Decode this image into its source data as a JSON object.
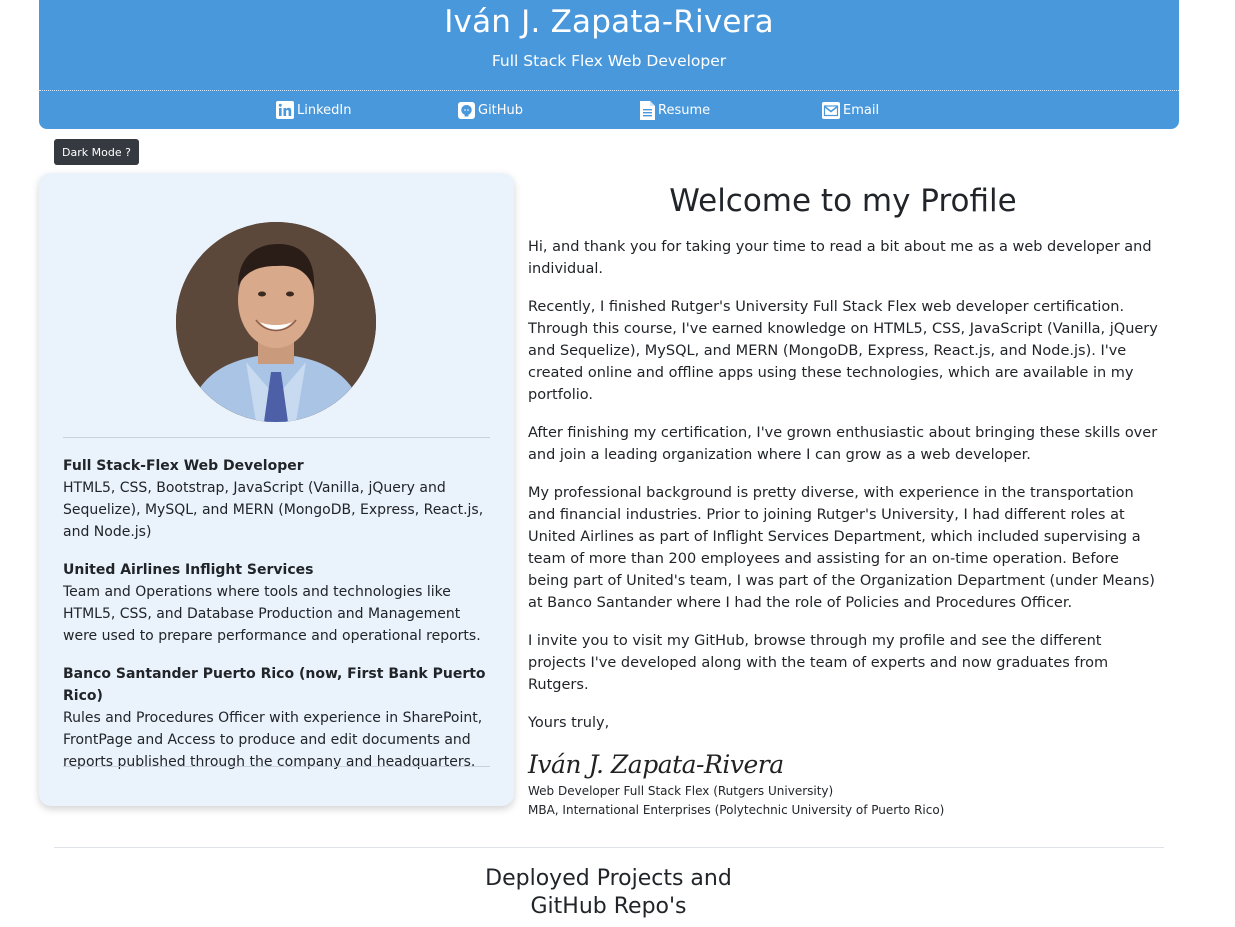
{
  "header": {
    "name": "Iván J. Zapata-Rivera",
    "subtitle": "Full Stack Flex Web Developer",
    "nav": [
      {
        "label": "LinkedIn",
        "icon": "linkedin-icon"
      },
      {
        "label": "GitHub",
        "icon": "github-icon"
      },
      {
        "label": "Resume",
        "icon": "document-icon"
      },
      {
        "label": "Email",
        "icon": "envelope-icon"
      }
    ]
  },
  "dark_mode_button": "Dark Mode ?",
  "sidebar": {
    "experience": [
      {
        "title": "Full Stack-Flex Web Developer",
        "text": "HTML5, CSS, Bootstrap, JavaScript (Vanilla, jQuery and Sequelize), MySQL, and MERN (MongoDB, Express, React.js, and Node.js)"
      },
      {
        "title": "United Airlines Inflight Services",
        "text": "Team and Operations where tools and technologies like HTML5, CSS, and Database Production and Management were used to prepare performance and operational reports."
      },
      {
        "title": "Banco Santander Puerto Rico (now, First Bank Puerto Rico)",
        "text": "Rules and Procedures Officer with experience in SharePoint, FrontPage and Access to produce and edit documents and reports published through the company and headquarters."
      }
    ]
  },
  "main": {
    "heading": "Welcome to my Profile",
    "paragraphs": [
      "Hi, and thank you for taking your time to read a bit about me as a web developer and individual.",
      "Recently, I finished Rutger's University Full Stack Flex web developer certification. Through this course, I've earned knowledge on HTML5, CSS, JavaScript (Vanilla, jQuery and Sequelize), MySQL, and MERN (MongoDB, Express, React.js, and Node.js). I've created online and offline apps using these technologies, which are available in my portfolio.",
      "After finishing my certification, I've grown enthusiastic about bringing these skills over and join a leading organization where I can grow as a web developer.",
      "My professional background is pretty diverse, with experience in the transportation and financial industries. Prior to joining Rutger's University, I had different roles at United Airlines as part of Inflight Services Department, which included supervising a team of more than 200 employees and assisting for an on-time operation. Before being part of United's team, I was part of the Organization Department (under Means) at Banco Santander where I had the role of Policies and Procedures Officer.",
      "I invite you to visit my GitHub, browse through my profile and see the different projects I've developed along with the team of experts and now graduates from Rutgers.",
      "Yours truly,"
    ],
    "signature": "Iván J. Zapata-Rivera",
    "credentials": [
      "Web Developer Full Stack Flex (Rutgers University)",
      "MBA, International Enterprises (Polytechnic University of Puerto Rico)"
    ]
  },
  "projects_section": {
    "title_line1": "Deployed Projects and",
    "title_line2": "GitHub Repo's"
  },
  "colors": {
    "header_bg": "#4a98dc",
    "card_bg": "#eaf2fb",
    "button_bg": "#343a40"
  }
}
